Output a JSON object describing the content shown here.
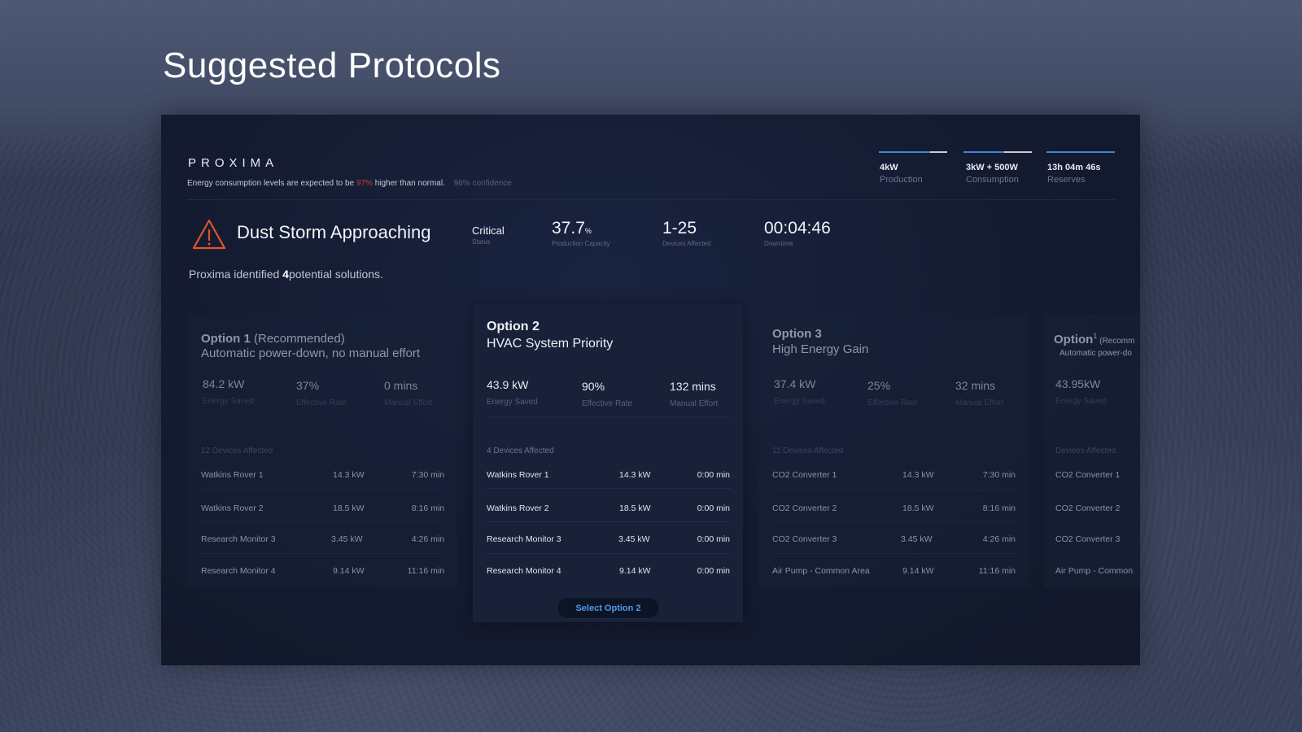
{
  "page": {
    "title": "Suggested Protocols"
  },
  "header": {
    "brand": "PROXIMA",
    "tagline_prefix": "Energy consumption levels are  expected to be ",
    "tagline_pct": "97%",
    "tagline_suffix": " higher than normal.",
    "confidence": "96% confidence",
    "metrics": [
      {
        "value": "4kW",
        "label": "Production",
        "fill_fraction": 0.75
      },
      {
        "value": "3kW + 500W",
        "label": "Consumption",
        "fill_fraction": 0.6
      },
      {
        "value": "13h 04m 46s",
        "label": "Reserves",
        "fill_fraction": 1.0
      }
    ]
  },
  "alert": {
    "icon": "warning-triangle-icon",
    "title": "Dust Storm Approaching",
    "status": {
      "value": "Critical",
      "label": "Status"
    },
    "production": {
      "value": "37.7",
      "unit": "%",
      "label": "Production Capacity"
    },
    "devices": {
      "value": "1-25",
      "label": "Devices Affected"
    },
    "downtime": {
      "value": "00:04:46",
      "label": "Downtime"
    },
    "identified_prefix": "Proxima identified ",
    "identified_count": "4",
    "identified_suffix": "potential solutions."
  },
  "options": [
    {
      "title_bold": "Option 1",
      "title_rest": " (Recommended)",
      "subtitle": "Automatic power-down, no manual effort",
      "metrics": [
        {
          "value": "84.2 kW",
          "label": "Energy Saved"
        },
        {
          "value": "37%",
          "label": "Effective Rate"
        },
        {
          "value": "0 mins",
          "label": "Manual Effort"
        }
      ],
      "devices_label": "12 Devices Affected",
      "rows": [
        [
          "Watkins Rover 1",
          "14.3 kW",
          "7:30 min"
        ],
        [
          "Watkins Rover 2",
          "18.5 kW",
          "8:16 min"
        ],
        [
          "Research Monitor 3",
          "3.45 kW",
          "4:26 min"
        ],
        [
          "Research Monitor 4",
          "9.14 kW",
          "11:16 min"
        ]
      ]
    },
    {
      "title_bold": "Option 2",
      "subtitle": "HVAC System Priority",
      "metrics": [
        {
          "value": "43.9 kW",
          "label": "Energy Saved"
        },
        {
          "value": "90%",
          "label": "Effective Rate"
        },
        {
          "value": "132 mins",
          "label": "Manual Effort"
        }
      ],
      "devices_label": "4 Devices Affected",
      "rows": [
        [
          "Watkins Rover 1",
          "14.3 kW",
          "0:00 min"
        ],
        [
          "Watkins Rover 2",
          "18.5 kW",
          "0:00 min"
        ],
        [
          "Research Monitor 3",
          "3.45 kW",
          "0:00 min"
        ],
        [
          "Research Monitor 4",
          "9.14 kW",
          "0:00 min"
        ]
      ],
      "button": "Select Option 2"
    },
    {
      "title_bold": "Option 3",
      "subtitle": "High Energy Gain",
      "metrics": [
        {
          "value": "37.4 kW",
          "label": "Energy Saved"
        },
        {
          "value": "25%",
          "label": "Effective Rate"
        },
        {
          "value": "32 mins",
          "label": "Manual Effort"
        }
      ],
      "devices_label": "11 Devices Affected",
      "rows": [
        [
          "CO2 Converter 1",
          "14.3 kW",
          "7:30 min"
        ],
        [
          "CO2 Converter 2",
          "18.5 kW",
          "8:16 min"
        ],
        [
          "CO2 Converter 3",
          "3.45 kW",
          "4:26 min"
        ],
        [
          "Air Pump - Common Area",
          "9.14 kW",
          "11:16 min"
        ]
      ]
    },
    {
      "title_bold": "Option",
      "title_sup": "1",
      "title_rest": " (Recomm",
      "subtitle": "Automatic power-do",
      "metrics": [
        {
          "value": "43.95kW",
          "label": "Energy Saved"
        }
      ],
      "devices_label": "Devices Affected",
      "rows": [
        [
          "CO2 Converter 1"
        ],
        [
          "CO2 Converter 2"
        ],
        [
          "CO2 Converter 3"
        ],
        [
          "Air Pump - Common"
        ]
      ]
    }
  ],
  "colors": {
    "accent_blue": "#3f86d6",
    "alert_red": "#d4362f",
    "alert_orange": "#e0552b",
    "button_text": "#4d9be8"
  }
}
